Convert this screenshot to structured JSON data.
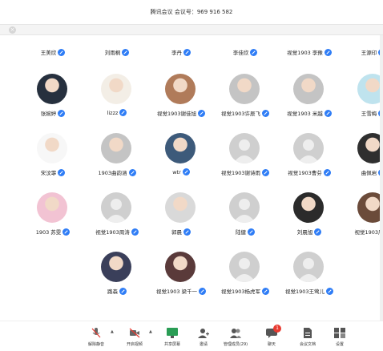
{
  "window": {
    "title": "腾讯会议  会议号：969 916 582"
  },
  "subbar": {
    "close_glyph": "×"
  },
  "participants": [
    {
      "name": "王美欣",
      "avatar": "none"
    },
    {
      "name": "刘雨桐",
      "avatar": "none"
    },
    {
      "name": "李丹",
      "avatar": "none"
    },
    {
      "name": "李佳欣",
      "avatar": "none"
    },
    {
      "name": "视觉1903 李豫",
      "avatar": "none"
    },
    {
      "name": "王源印",
      "avatar": "none"
    },
    {
      "name": "张婉婷",
      "avatar": "photo"
    },
    {
      "name": "lizzz",
      "avatar": "photo"
    },
    {
      "name": "视觉1903谢佳旭",
      "avatar": "photo"
    },
    {
      "name": "视觉1903许辰飞",
      "avatar": "photo"
    },
    {
      "name": "视觉1903 米越",
      "avatar": "photo"
    },
    {
      "name": "王雪梅",
      "avatar": "photo"
    },
    {
      "name": "宋汶霏",
      "avatar": "photo"
    },
    {
      "name": "1903曲韵涵",
      "avatar": "photo"
    },
    {
      "name": "wtr",
      "avatar": "photo"
    },
    {
      "name": "视觉1903谢诗雨",
      "avatar": "default"
    },
    {
      "name": "视觉1903曹芬",
      "avatar": "default"
    },
    {
      "name": "曲佩岩",
      "avatar": "photo"
    },
    {
      "name": "1903 苏雯",
      "avatar": "photo"
    },
    {
      "name": "视觉1903周涛",
      "avatar": "default"
    },
    {
      "name": "郭晨",
      "avatar": "photo"
    },
    {
      "name": "陆健",
      "avatar": "default"
    },
    {
      "name": "刘晨旭",
      "avatar": "photo"
    },
    {
      "name": "视觉1903周",
      "avatar": "photo"
    },
    {
      "name": "路森",
      "avatar": "photo"
    },
    {
      "name": "视觉1903 梁千一",
      "avatar": "photo"
    },
    {
      "name": "视觉1903杨虎军",
      "avatar": "default"
    },
    {
      "name": "视觉1903王莺儿",
      "avatar": "default"
    }
  ],
  "toolbar": {
    "mute": "解除静音",
    "video": "开启视频",
    "share": "共享屏幕",
    "invite": "邀请",
    "members": "管理成员(29)",
    "chat": "聊天",
    "chat_badge": "1",
    "docs": "会议文档",
    "settings": "设置"
  },
  "colors": {
    "accent": "#2f7df6",
    "badge": "#e83a30"
  }
}
